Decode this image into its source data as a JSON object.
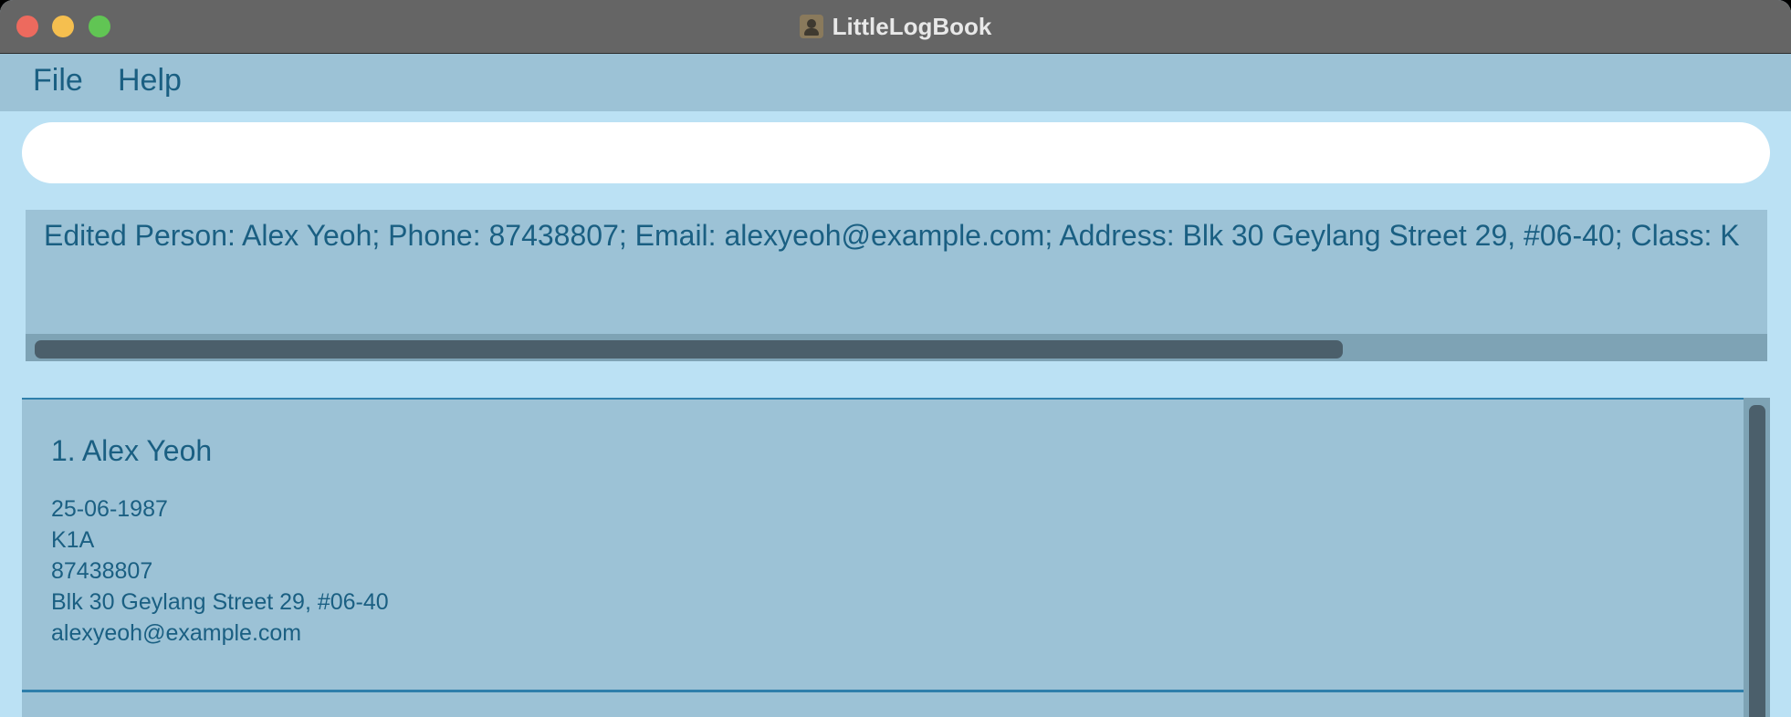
{
  "window": {
    "title": "LittleLogBook"
  },
  "menu": {
    "file": "File",
    "help": "Help"
  },
  "command": {
    "value": ""
  },
  "result": {
    "text": "Edited Person: Alex Yeoh; Phone: 87438807; Email: alexyeoh@example.com; Address: Blk 30 Geylang Street 29, #06-40; Class: K"
  },
  "persons": [
    {
      "name": "1. Alex Yeoh",
      "birthday": "25-06-1987",
      "class": "K1A",
      "phone": "87438807",
      "address": "Blk 30 Geylang Street 29, #06-40",
      "email": "alexyeoh@example.com"
    }
  ]
}
